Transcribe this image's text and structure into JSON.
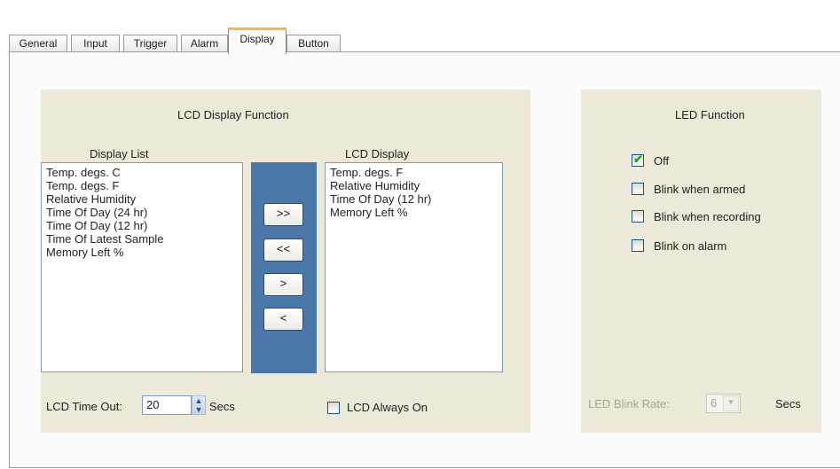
{
  "tabs": [
    "General",
    "Input",
    "Trigger",
    "Alarm",
    "Display",
    "Button"
  ],
  "active_tab": "Display",
  "lcd": {
    "group_title": "LCD Display Function",
    "display_list_title": "Display List",
    "display_list": [
      "Temp. degs. C",
      "Temp. degs. F",
      "Relative Humidity",
      "Time Of Day (24 hr)",
      "Time Of Day (12 hr)",
      "Time Of Latest Sample",
      "Memory Left %"
    ],
    "lcd_display_title": "LCD Display",
    "lcd_display": [
      "Temp. degs. F",
      "Relative Humidity",
      "Time Of Day (12 hr)",
      "Memory Left %"
    ],
    "buttons": {
      "add_all": ">>",
      "remove_all": "<<",
      "add_one": ">",
      "remove_one": "<"
    },
    "timeout_label": "LCD Time Out:",
    "timeout_value": "20",
    "timeout_unit": "Secs",
    "always_on_label": "LCD Always On",
    "always_on_checked": false
  },
  "led": {
    "group_title": "LED Function",
    "options": [
      {
        "label": "Off",
        "checked": true
      },
      {
        "label": "Blink when armed",
        "checked": false
      },
      {
        "label": "Blink when recording",
        "checked": false
      },
      {
        "label": "Blink on alarm",
        "checked": false
      }
    ],
    "blink_rate_label": "LED Blink Rate:",
    "blink_rate_value": "6",
    "blink_rate_unit": "Secs"
  },
  "icons": {
    "spin": "spin-updown-icon",
    "check": "checkmark-icon",
    "dropdown": "chevron-down-icon"
  },
  "colors": {
    "group_bg": "#ece9d8",
    "transfer_panel": "#4a77a8",
    "active_tab_accent": "#f4b74b",
    "check": "#21a121"
  }
}
